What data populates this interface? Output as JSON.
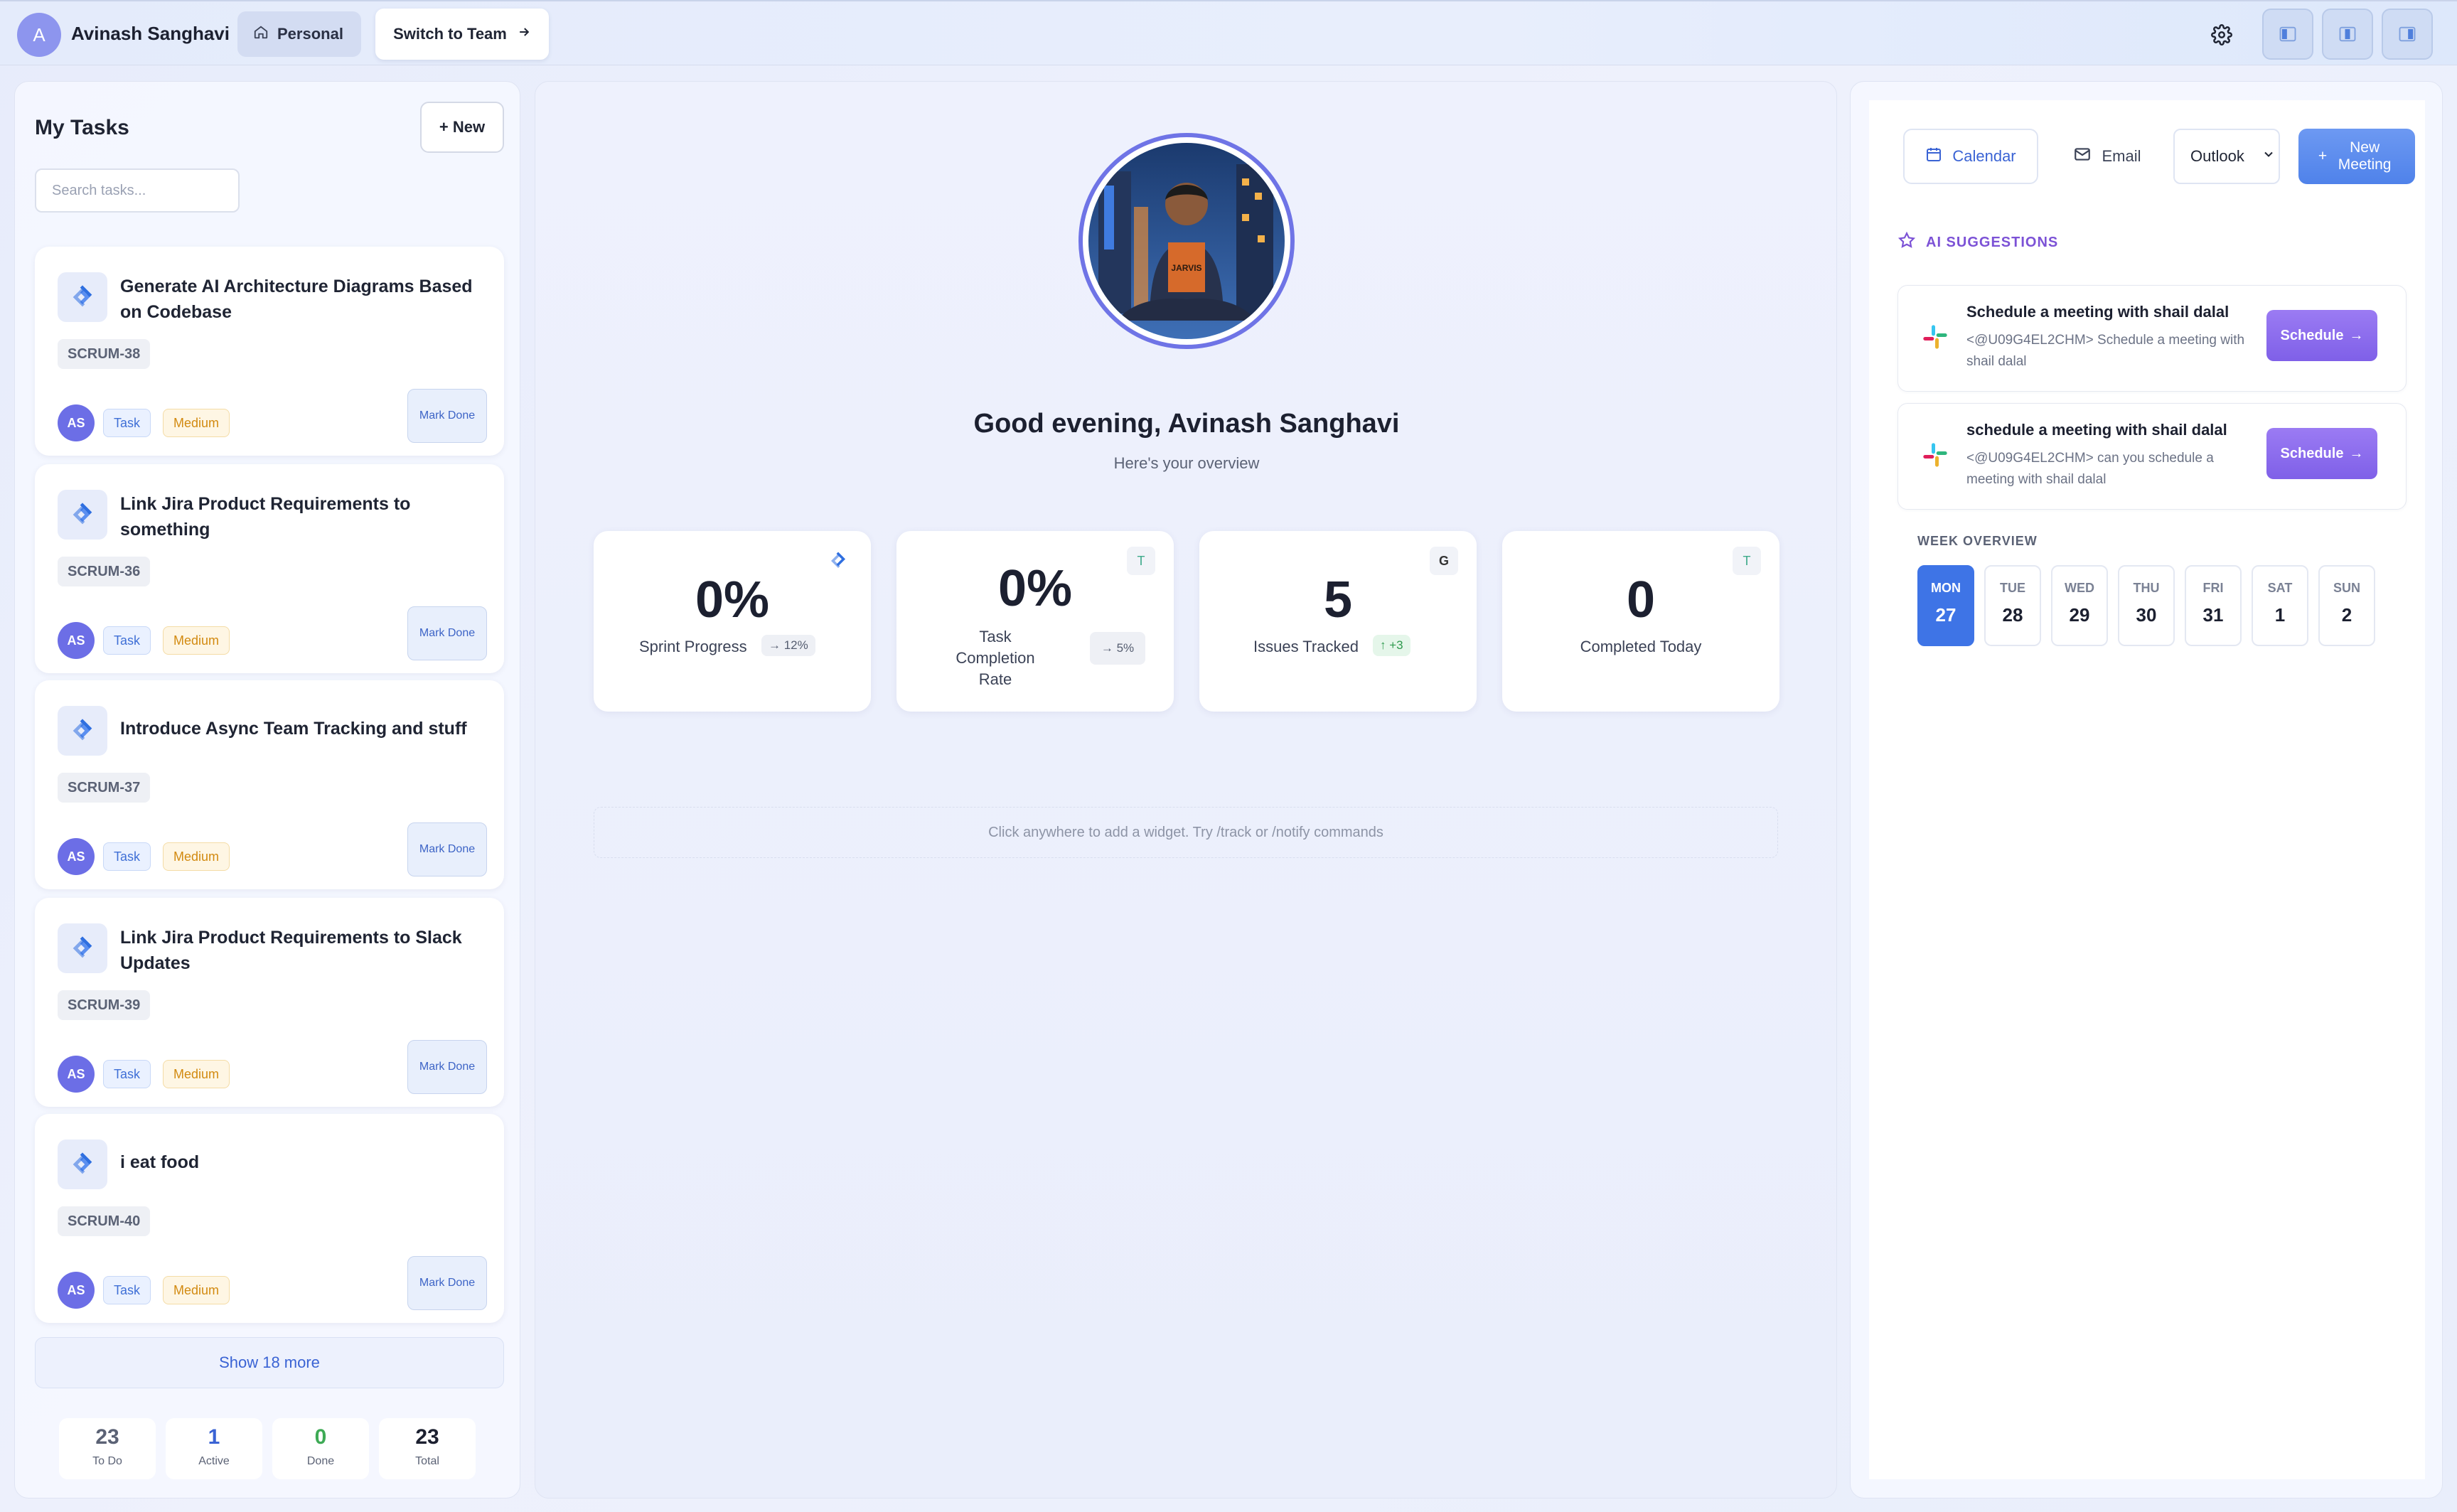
{
  "topbar": {
    "avatar_initial": "A",
    "user_name": "Avinash Sanghavi",
    "personal_label": "Personal",
    "switch_team_label": "Switch to Team"
  },
  "tasks": {
    "heading": "My Tasks",
    "new_label": "+ New",
    "search_placeholder": "Search tasks...",
    "items": [
      {
        "title": "Generate AI Architecture Diagrams Based on Codebase",
        "code": "SCRUM-38",
        "assignee": "AS",
        "type": "Task",
        "priority": "Medium",
        "action": "Mark Done"
      },
      {
        "title": "Link Jira Product Requirements to something",
        "code": "SCRUM-36",
        "assignee": "AS",
        "type": "Task",
        "priority": "Medium",
        "action": "Mark Done"
      },
      {
        "title": "Introduce Async Team Tracking and stuff",
        "code": "SCRUM-37",
        "assignee": "AS",
        "type": "Task",
        "priority": "Medium",
        "action": "Mark Done"
      },
      {
        "title": "Link Jira Product Requirements to Slack Updates",
        "code": "SCRUM-39",
        "assignee": "AS",
        "type": "Task",
        "priority": "Medium",
        "action": "Mark Done"
      },
      {
        "title": "i eat food",
        "code": "SCRUM-40",
        "assignee": "AS",
        "type": "Task",
        "priority": "Medium",
        "action": "Mark Done"
      }
    ],
    "show_more_label": "Show 18 more",
    "stats": [
      {
        "value": "23",
        "label": "To Do",
        "color": "#5b6275"
      },
      {
        "value": "1",
        "label": "Active",
        "color": "#3a63d4"
      },
      {
        "value": "0",
        "label": "Done",
        "color": "#3eaa55"
      },
      {
        "value": "23",
        "label": "Total",
        "color": "#1c2030"
      }
    ]
  },
  "overview": {
    "greeting": "Good evening, Avinash Sanghavi",
    "subtitle": "Here's your overview",
    "metrics": [
      {
        "value": "0%",
        "label": "Sprint Progress",
        "badge": "→ 12%",
        "corner": "jira-icon"
      },
      {
        "value": "0%",
        "label": "Task Completion Rate",
        "badge": "→ 5%",
        "corner": "T"
      },
      {
        "value": "5",
        "label": "Issues Tracked",
        "badge": "↑ +3",
        "corner": "G"
      },
      {
        "value": "0",
        "label": "Completed Today",
        "badge": "",
        "corner": "T"
      }
    ],
    "widget_hint": "Click anywhere to add a widget. Try /track or /notify commands"
  },
  "schedule": {
    "calendar_tab": "Calendar",
    "email_tab": "Email",
    "provider": "Outlook",
    "new_meeting_label": "New Meeting",
    "ai_heading": "AI SUGGESTIONS",
    "suggestions": [
      {
        "title": "Schedule a meeting with shail dalal",
        "desc": "<@U09G4EL2CHM> Schedule a meeting with shail dalal",
        "action": "Schedule"
      },
      {
        "title": "schedule a meeting with shail dalal",
        "desc": "<@U09G4EL2CHM> can you schedule a meeting with shail dalal",
        "action": "Schedule"
      }
    ],
    "week_heading": "WEEK OVERVIEW",
    "days": [
      {
        "name": "MON",
        "date": "27"
      },
      {
        "name": "TUE",
        "date": "28"
      },
      {
        "name": "WED",
        "date": "29"
      },
      {
        "name": "THU",
        "date": "30"
      },
      {
        "name": "FRI",
        "date": "31"
      },
      {
        "name": "SAT",
        "date": "1"
      },
      {
        "name": "SUN",
        "date": "2"
      }
    ]
  },
  "colors": {
    "accent": "#3e74e6",
    "ai_purple": "#7f60e8",
    "jira_blue": "#2f6fe0"
  }
}
